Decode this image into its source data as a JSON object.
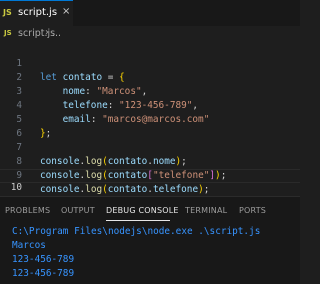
{
  "tab": {
    "label": "script.js",
    "close": "×",
    "badge": "JS"
  },
  "breadcrumb": {
    "badge": "JS",
    "file": "script.js",
    "sep": "›",
    "more": "..."
  },
  "editor": {
    "lines": [
      {
        "n": "1"
      },
      {
        "n": "2"
      },
      {
        "n": "3"
      },
      {
        "n": "4"
      },
      {
        "n": "5"
      },
      {
        "n": "6"
      },
      {
        "n": "7"
      },
      {
        "n": "8"
      },
      {
        "n": "9"
      },
      {
        "n": "10"
      }
    ],
    "code": {
      "l1_kw": "let",
      "l1_var": "contato",
      "l1_eq": " = ",
      "l1_brace": "{",
      "l2_key": "nome",
      "l2_colon": ": ",
      "l2_val": "\"Marcos\"",
      "l2_comma": ",",
      "l3_key": "telefone",
      "l3_colon": ": ",
      "l3_val": "\"123-456-789\"",
      "l3_comma": ",",
      "l4_key": "email",
      "l4_colon": ": ",
      "l4_val": "\"marcos@marcos.com\"",
      "l5_brace": "}",
      "l5_semi": ";",
      "l7_obj": "console",
      "l7_dot": ".",
      "l7_fn": "log",
      "l7_p1": "(",
      "l7_arg": "contato",
      "l7_dot2": ".",
      "l7_prop": "nome",
      "l7_p2": ")",
      "l7_semi": ";",
      "l8_obj": "console",
      "l8_dot": ".",
      "l8_fn": "log",
      "l8_p1": "(",
      "l8_arg": "contato",
      "l8_b1": "[",
      "l8_str": "\"telefone\"",
      "l8_b2": "]",
      "l8_p2": ")",
      "l8_semi": ";",
      "l9_obj": "console",
      "l9_dot": ".",
      "l9_fn": "log",
      "l9_p1": "(",
      "l9_arg": "contato",
      "l9_dot2": ".",
      "l9_prop": "telefone",
      "l9_p2": ")",
      "l9_semi": ";"
    }
  },
  "panel": {
    "tabs": [
      "PROBLEMS",
      "OUTPUT",
      "DEBUG CONSOLE",
      "TERMINAL",
      "PORTS"
    ],
    "output": [
      "C:\\Program Files\\nodejs\\node.exe .\\script.js",
      "Marcos",
      "123-456-789",
      "123-456-789"
    ]
  },
  "colors": {
    "accent": "#0078d4",
    "output": "#3794ff",
    "keyword": "#569cd6",
    "string": "#ce9178"
  }
}
